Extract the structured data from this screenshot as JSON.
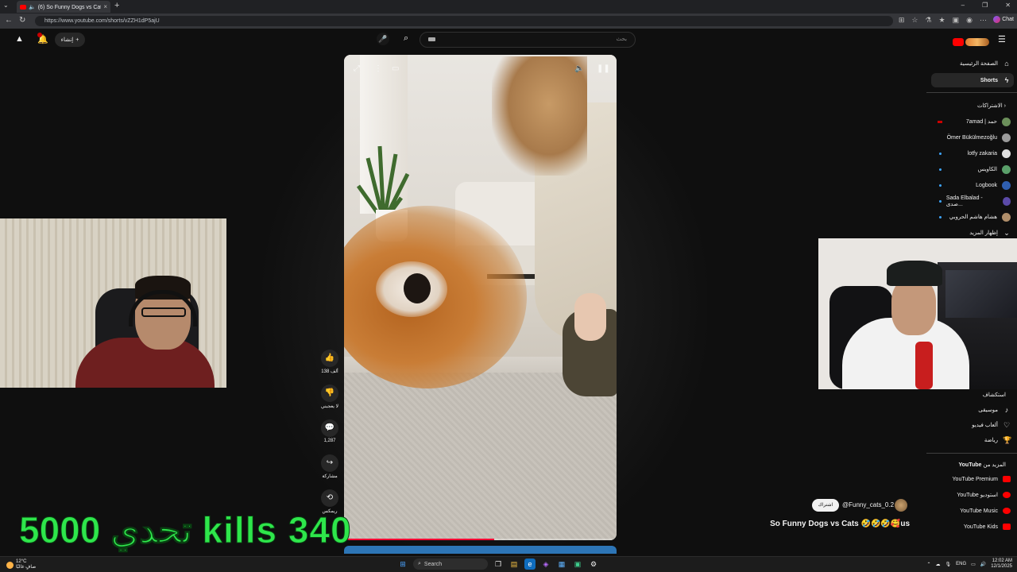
{
  "browser": {
    "tab_title": "(6) So Funny Dogs vs Cats 🤩",
    "url": "https://www.youtube.com/shorts/vZZH1dP5ajU",
    "chat_label": "Chat"
  },
  "yt_header": {
    "create_label": "إنشاء",
    "search_placeholder": "بحث",
    "notification_count": "9"
  },
  "sidebar": {
    "home_label": "الصفحة الرئيسية",
    "shorts_label": "Shorts",
    "subscriptions_heading": "الاشتراكات",
    "subscriptions": [
      {
        "label": "7amad | حمد",
        "color": "#6b8f5a"
      },
      {
        "label": "Ömer Bükülmezoğlu",
        "color": "#9a9a9a"
      },
      {
        "label": "lotfy zakaria",
        "color": "#e0e0e0"
      },
      {
        "label": "الكاويس",
        "color": "#5aa06a"
      },
      {
        "label": "Logbook",
        "color": "#2f5fb0"
      },
      {
        "label": "Sada Elbalad - صدى...",
        "color": "#5b4aa8"
      },
      {
        "label": "هشام هاشم الحروبي",
        "color": "#b08e6a"
      }
    ],
    "show_more": "إظهار المزيد",
    "explore_heading": "استكشاف",
    "explore_items": [
      {
        "label": "موسيقى",
        "icon": "music-icon"
      },
      {
        "label": "ألعاب فيديو",
        "icon": "gaming-icon"
      },
      {
        "label": "رياضة",
        "icon": "trophy-icon"
      }
    ],
    "more_heading_brand": "YouTube",
    "more_heading_prefix": "المزيد من",
    "more_items": [
      {
        "label": "YouTube Premium"
      },
      {
        "label": "YouTube استوديو"
      },
      {
        "label": "YouTube Music"
      },
      {
        "label": "YouTube Kids"
      }
    ]
  },
  "short": {
    "likes": "138 ألف",
    "dislike_label": "لا يعجبني",
    "comments": "1,287",
    "share_label": "مشاركة",
    "remix_label": "ريمكس",
    "channel": "@Funny_cats_0.2",
    "subscribe_label": "اشتراك",
    "title": "So Funny Dogs vs Cats 🤣🤣🤣🥰us",
    "progress": 0.55
  },
  "overlay": {
    "kills_text": "تحدي 5000 kills 340"
  },
  "taskbar": {
    "temperature": "12°C",
    "weather": "صافٍ غالبًا",
    "search_label": "Search",
    "language": "ENG",
    "time": "12:02 AM",
    "date": "12/1/2025"
  }
}
